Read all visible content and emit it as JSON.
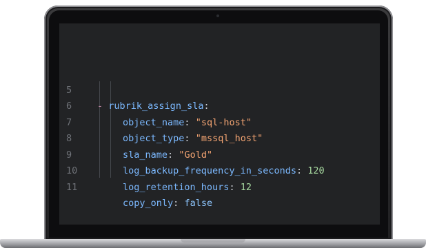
{
  "editor": {
    "lines": [
      {
        "number": "5",
        "dash": "-",
        "key": "rubrik_assign_sla",
        "colon": ":",
        "value": "",
        "value_type": "none"
      },
      {
        "number": "6",
        "dash": "",
        "key": "object_name",
        "colon": ":",
        "value": "\"sql-host\"",
        "value_type": "string"
      },
      {
        "number": "7",
        "dash": "",
        "key": "object_type",
        "colon": ":",
        "value": "\"mssql_host\"",
        "value_type": "string"
      },
      {
        "number": "8",
        "dash": "",
        "key": "sla_name",
        "colon": ":",
        "value": "\"Gold\"",
        "value_type": "string"
      },
      {
        "number": "9",
        "dash": "",
        "key": "log_backup_frequency_in_seconds",
        "colon": ":",
        "value": "120",
        "value_type": "number"
      },
      {
        "number": "10",
        "dash": "",
        "key": "log_retention_hours",
        "colon": ":",
        "value": "12",
        "value_type": "number"
      },
      {
        "number": "11",
        "dash": "",
        "key": "copy_only",
        "colon": ":",
        "value": "false",
        "value_type": "boolean"
      }
    ]
  },
  "colors": {
    "screen_background": "#222325",
    "line_number": "#6f7278",
    "key": "#7cb9ff",
    "string": "#f3a472",
    "number": "#a7d9a0",
    "boolean": "#8fc7ff",
    "dash": "#c48aa8"
  }
}
